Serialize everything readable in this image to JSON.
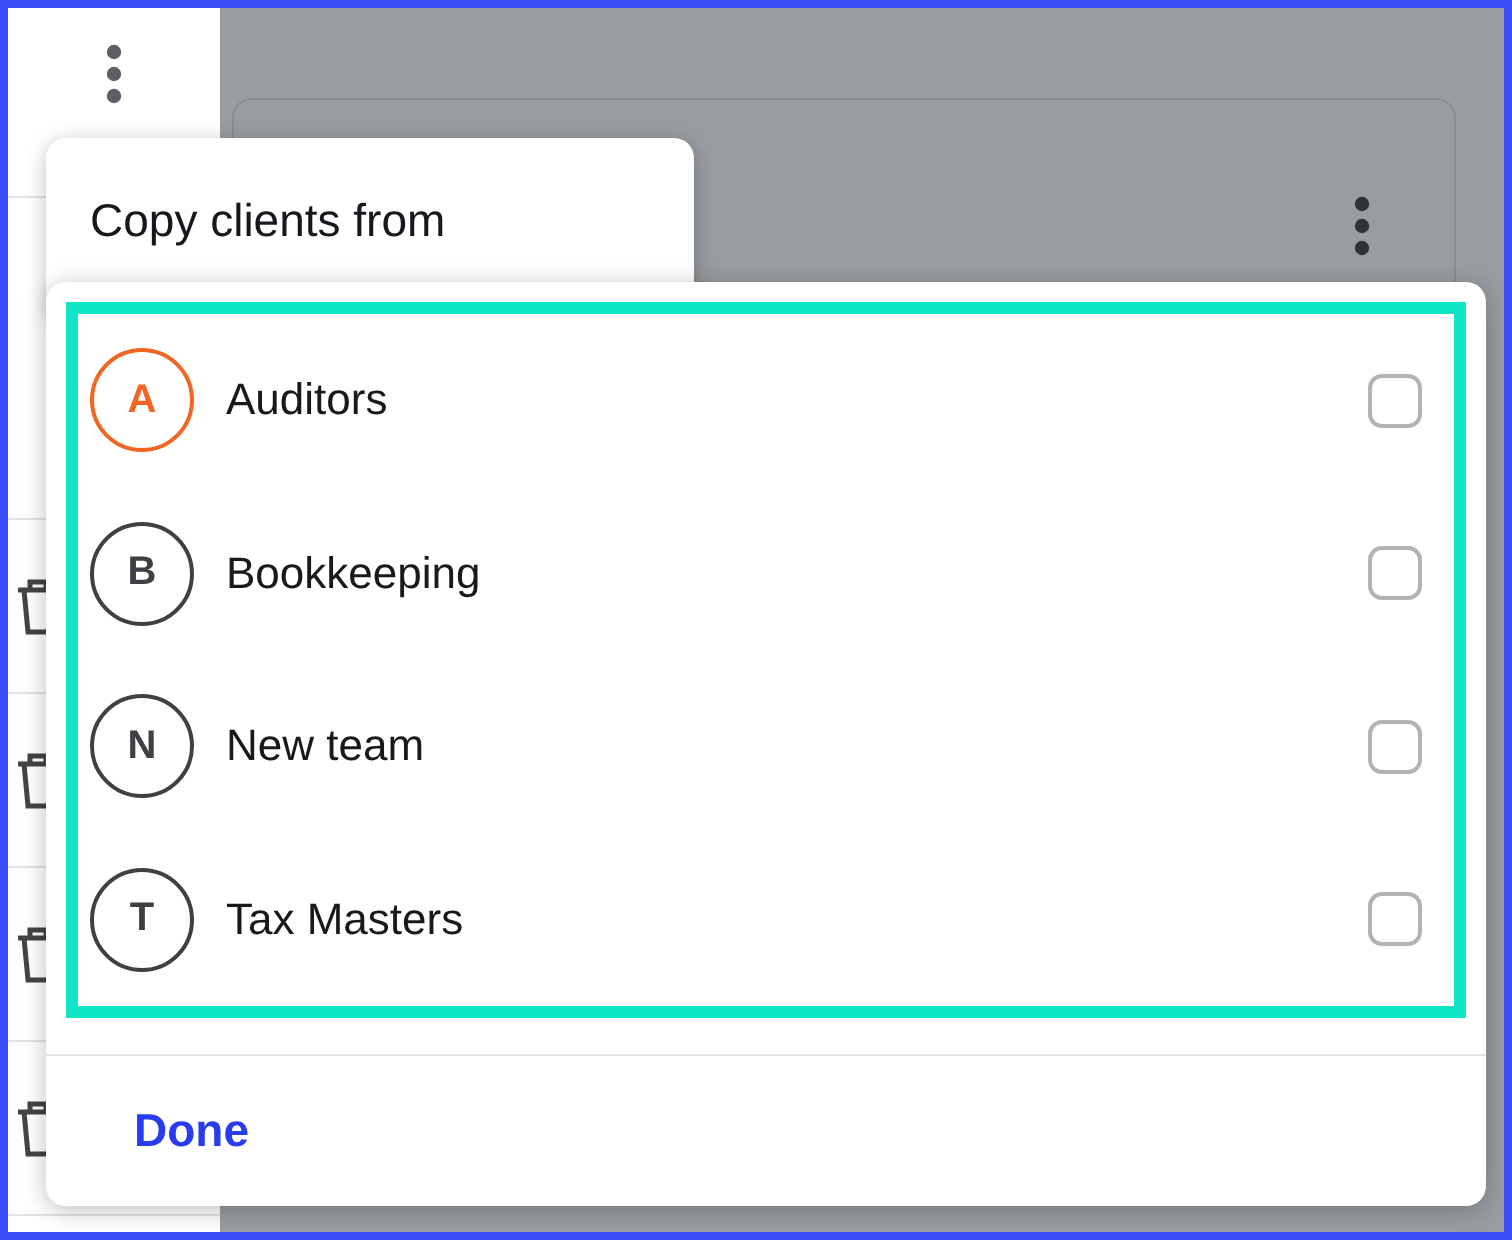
{
  "sidebar": {
    "rows": [
      {
        "kind": "trash"
      },
      {
        "kind": "trash"
      },
      {
        "kind": "trash"
      },
      {
        "kind": "trash"
      }
    ]
  },
  "menu": {
    "title": "Copy clients from"
  },
  "teams": [
    {
      "initial": "A",
      "name": "Auditors",
      "color": "#f26522",
      "checked": false
    },
    {
      "initial": "B",
      "name": "Bookkeeping",
      "color": "#3f4044",
      "checked": false
    },
    {
      "initial": "N",
      "name": "New team",
      "color": "#3f4044",
      "checked": false
    },
    {
      "initial": "T",
      "name": "Tax Masters",
      "color": "#3f4044",
      "checked": false
    }
  ],
  "done_button": "Done"
}
